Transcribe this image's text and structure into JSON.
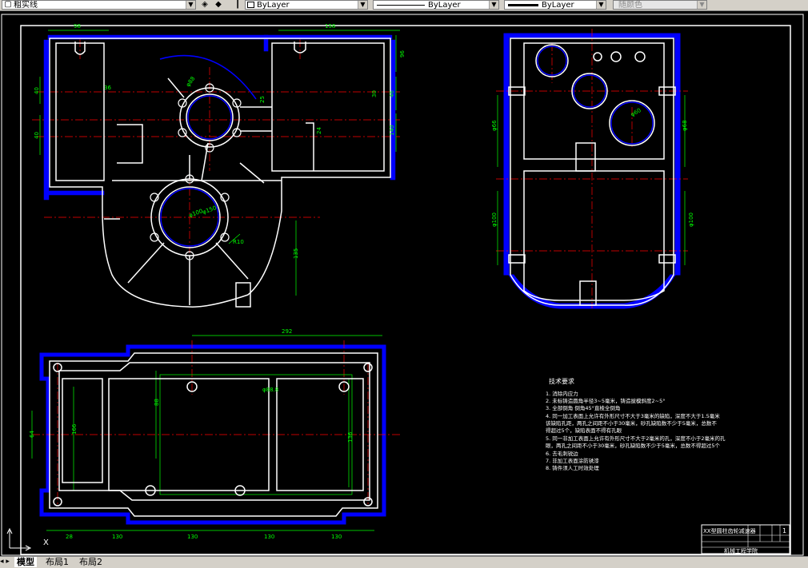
{
  "toolbar": {
    "layer": {
      "name": "粗实线",
      "icon": "layer-status-icon"
    },
    "linetype": {
      "label": "ByLayer"
    },
    "lineweight": {
      "label": "ByLayer"
    },
    "lineweight2": {
      "label": "ByLayer"
    },
    "plotstyle": {
      "label": "随颜色"
    }
  },
  "drawing": {
    "colors": {
      "outline": "#ffffff",
      "hatch": "#0000ff",
      "center": "#ff0000",
      "dimension": "#00ff00",
      "background": "#000000"
    },
    "front_view": {
      "dims": [
        "98",
        "158",
        "96",
        "46",
        "36",
        "40",
        "40",
        "140",
        "24",
        "30",
        "25",
        "φ88",
        "φ100",
        "φ150",
        "R10",
        "135"
      ]
    },
    "side_view": {
      "dims": [
        "φ66",
        "φ68",
        "φ60",
        "φ100",
        "φ100"
      ]
    },
    "bottom_view": {
      "dims": [
        "292",
        "88",
        "166",
        "64",
        "136",
        "28",
        "130",
        "130",
        "130",
        "130",
        "φ88.8"
      ]
    },
    "tech_requirements": {
      "title": "技术要求",
      "items": [
        "1. 消除内应力",
        "2. 未标铸造圆角半径3~5毫米，铸造拔模斜度2~5°",
        "3. 全部倒角 倒角45°直棱全倒角",
        "4. 同一加工表面上允许有外形尺寸不大于3毫米的缺陷，深度不大于1.5毫米",
        "   该缺陷孔距，两孔之间距不小于30毫米，砂孔缺陷数不少于5毫米，总数不",
        "   得超过5个，缺陷表面不得有孔眼",
        "5. 同一非加工表面上允许有外形尺寸不大于2毫米的孔，深度不小于2毫米的孔",
        "   眼，两孔之间距不小于30毫米，砂孔缺陷数不少于5毫米，总数不得超过5个",
        "6. 去毛刺锐边",
        "7. 非加工表面涂防锈漆",
        "8. 铸件须人工时效处理"
      ]
    },
    "title_block": {
      "name": "XX型圆柱齿轮减速器",
      "sheet": "1",
      "school": "机械工程学院",
      "scale": "1"
    }
  },
  "layout_tabs": [
    {
      "label": "模型",
      "active": true
    },
    {
      "label": "布局1",
      "active": false
    },
    {
      "label": "布局2",
      "active": false
    }
  ],
  "tab_nav": "◂ ▸"
}
